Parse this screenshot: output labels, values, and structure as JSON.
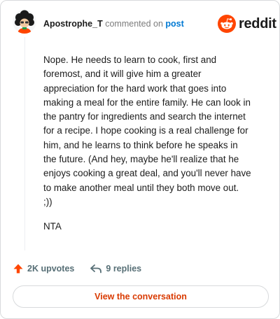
{
  "header": {
    "username": "Apostrophe_T",
    "action_text": "commented on",
    "post_link": "post",
    "brand": "reddit"
  },
  "comment": {
    "body": "Nope. He needs to learn to cook, first and\nforemost, and it will give him a greater\nappreciation for the hard work that goes into\nmaking a meal for the entire family. He can look in\nthe pantry for ingredients and search the internet\nfor a recipe. I hope cooking is a real challenge for\nhim, and he learns to think before he speaks in\nthe future. (And hey, maybe he'll realize that he\nenjoys cooking a great deal, and you'll never have\nto make another meal until they both move out.\n;))",
    "verdict": "NTA"
  },
  "actions": {
    "upvotes": "2K upvotes",
    "replies": "9 replies"
  },
  "cta": {
    "label": "View the conversation"
  },
  "icons": {
    "avatar": "avatar-icon",
    "brand": "reddit-logo-icon",
    "upvote": "upvote-arrow-icon",
    "reply": "reply-arrow-icon"
  },
  "colors": {
    "brand_orange": "#ff4500",
    "link_blue": "#0079d3",
    "cta_text": "#d93a00",
    "muted": "#576f76"
  }
}
